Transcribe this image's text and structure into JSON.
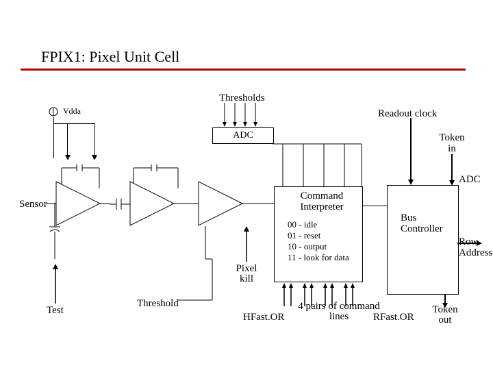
{
  "title": "FPIX1: Pixel Unit Cell",
  "labels": {
    "thresholds": "Thresholds",
    "readout_clock": "Readout clock",
    "vdda": "Vdda",
    "adc": "ADC",
    "adc_out": "ADC",
    "token_in": "Token in",
    "command_interpreter": "Command Interpreter",
    "bus_controller": "Bus Controller",
    "row_address": "Row Address",
    "pixel_kill": "Pixel kill",
    "threshold": "Threshold",
    "hfastor": "HFast.OR",
    "rfastor": "RFast.OR",
    "token_out": "Token out",
    "sensor": "Sensor",
    "test": "Test",
    "cmd_pairs": "4 pairs of command lines",
    "modes": {
      "m00": "00 - idle",
      "m01": "01 - reset",
      "m10": "10 - output",
      "m11": "11 - look for data"
    }
  }
}
